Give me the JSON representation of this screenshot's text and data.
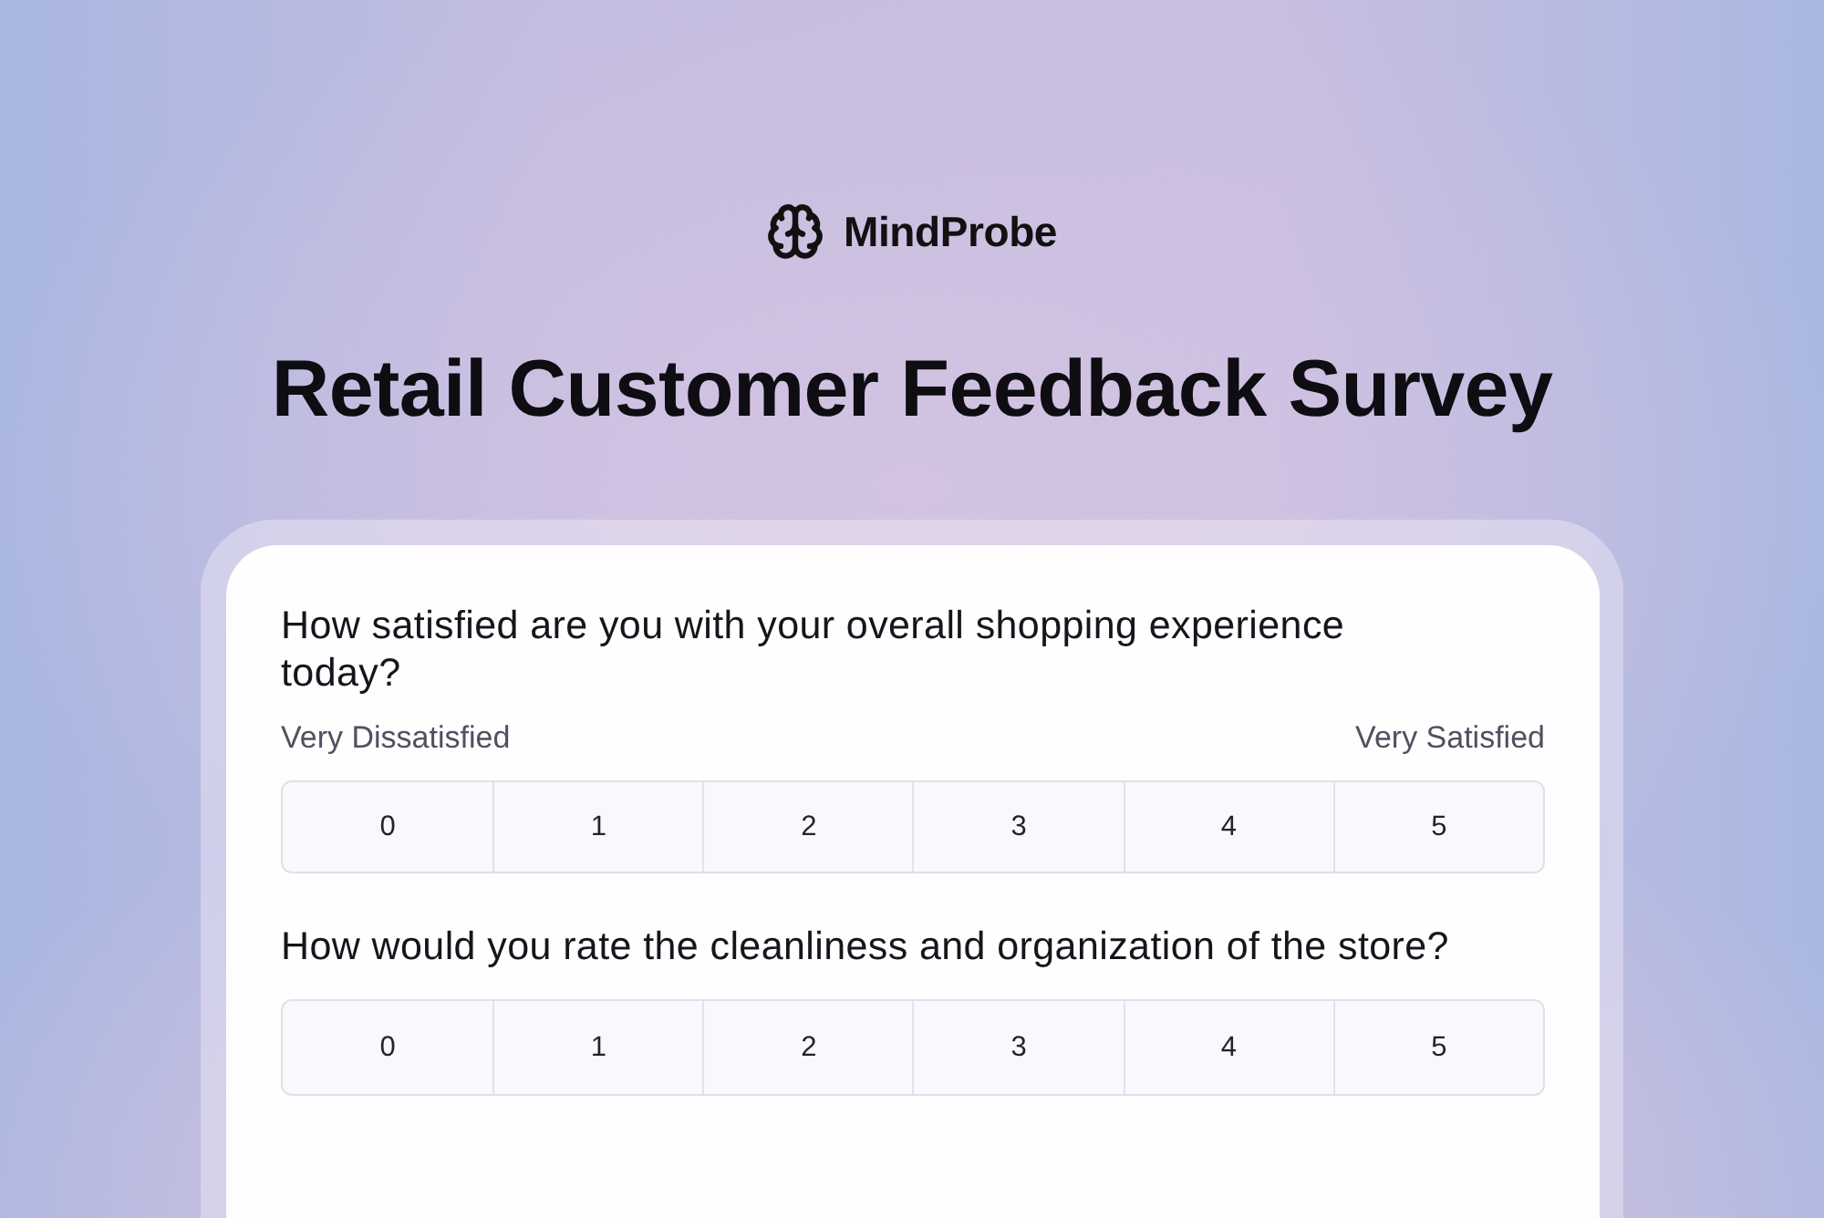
{
  "brand": {
    "name": "MindProbe"
  },
  "title": "Retail Customer Feedback Survey",
  "questions": [
    {
      "text": "How satisfied are you with your overall shopping experience today?",
      "labels": {
        "low": "Very Dissatisfied",
        "high": "Very Satisfied"
      },
      "options": [
        {
          "label": "0",
          "selected": false
        },
        {
          "label": "1",
          "selected": false
        },
        {
          "label": "2",
          "selected": false
        },
        {
          "label": "3",
          "selected": false
        },
        {
          "label": "4",
          "selected": false
        },
        {
          "label": "5",
          "selected": false
        }
      ]
    },
    {
      "text": "How would you rate the cleanliness and organization of the store?",
      "options": [
        {
          "label": "0",
          "selected": false
        },
        {
          "label": "1",
          "selected": false
        },
        {
          "label": "2",
          "selected": false
        },
        {
          "label": "3",
          "selected": false
        },
        {
          "label": "4",
          "selected": false
        },
        {
          "label": "5",
          "selected": false
        }
      ]
    }
  ]
}
